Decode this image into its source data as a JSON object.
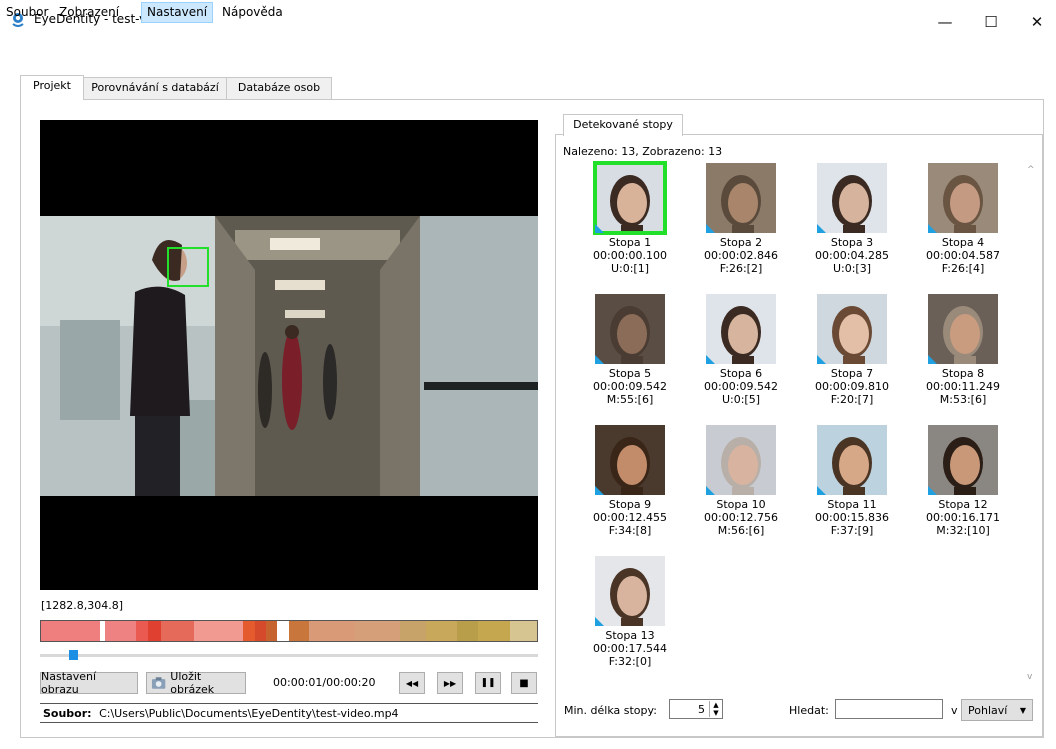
{
  "window": {
    "title": "EyeDentity - test-video",
    "minimize": "—",
    "maximize": "☐",
    "close": "✕"
  },
  "menu": [
    "Soubor",
    "Zobrazení",
    "Nastavení",
    "Nápověda"
  ],
  "tabs": [
    "Projekt",
    "Porovnávání s databází",
    "Databáze osob"
  ],
  "player": {
    "coordinates": "[1282.8,304.8]",
    "settings_button": "Nastavení obrazu",
    "save_button": "Uložit obrázek",
    "time": "00:00:01/00:00:20",
    "progress_fraction": 0.05,
    "file_label": "Soubor:",
    "file_path": "C:\\Users\\Public\\Documents\\EyeDentity\\test-video.mp4",
    "btn_rewind": "◀◀",
    "btn_forward": "▶▶",
    "btn_pause": "❚❚",
    "btn_stop": "■"
  },
  "timeline_colors": [
    "#ef7f7f",
    "#ffffff",
    "#ee8282",
    "#ea5a50",
    "#e04030",
    "#e66a5a",
    "#f09a92",
    "#e55b2e",
    "#d44a2a",
    "#c7632e",
    "#ffffff",
    "#c9763c",
    "#d89a77",
    "#d49f79",
    "#c7a36a",
    "#c8a85a",
    "#b89e4a",
    "#c5a750",
    "#d6c590"
  ],
  "right_panel": {
    "tab": "Detekované stopy",
    "summary": "Nalezeno: 13, Zobrazeno: 13",
    "min_length_label": "Min. délka stopy:",
    "min_length_value": "5",
    "search_label": "Hledat:",
    "search_value": "",
    "in_label": "v",
    "search_field_select": "Pohlaví"
  },
  "tracks": [
    {
      "name": "Stopa 1",
      "time": "00:00:00.100",
      "info": "U:0:[1]",
      "selected": true,
      "skin": "#d8b39a",
      "hair": "#3b2a22",
      "bg": "#d7dde3"
    },
    {
      "name": "Stopa 2",
      "time": "00:00:02.846",
      "info": "F:26:[2]",
      "selected": false,
      "skin": "#a9866b",
      "hair": "#5a4a3c",
      "bg": "#8b7a68"
    },
    {
      "name": "Stopa 3",
      "time": "00:00:04.285",
      "info": "U:0:[3]",
      "selected": false,
      "skin": "#d5b39c",
      "hair": "#3a2a22",
      "bg": "#dfe4ea"
    },
    {
      "name": "Stopa 4",
      "time": "00:00:04.587",
      "info": "F:26:[4]",
      "selected": false,
      "skin": "#c59a82",
      "hair": "#6a5442",
      "bg": "#9a8a7a"
    },
    {
      "name": "Stopa 5",
      "time": "00:00:09.542",
      "info": "M:55:[6]",
      "selected": false,
      "skin": "#8a6c58",
      "hair": "#4a3c32",
      "bg": "#5a4e44"
    },
    {
      "name": "Stopa 6",
      "time": "00:00:09.542",
      "info": "U:0:[5]",
      "selected": false,
      "skin": "#d6b49d",
      "hair": "#3b2a22",
      "bg": "#dfe4ea"
    },
    {
      "name": "Stopa 7",
      "time": "00:00:09.810",
      "info": "F:20:[7]",
      "selected": false,
      "skin": "#e2bfa6",
      "hair": "#6a4a34",
      "bg": "#cfd7df"
    },
    {
      "name": "Stopa 8",
      "time": "00:00:11.249",
      "info": "M:53:[6]",
      "selected": false,
      "skin": "#c99c80",
      "hair": "#9a8a7a",
      "bg": "#6a6058"
    },
    {
      "name": "Stopa 9",
      "time": "00:00:12.455",
      "info": "F:34:[8]",
      "selected": false,
      "skin": "#c28c6a",
      "hair": "#3a2618",
      "bg": "#4a3a2e"
    },
    {
      "name": "Stopa 10",
      "time": "00:00:12.756",
      "info": "M:56:[6]",
      "selected": false,
      "skin": "#d8b4a0",
      "hair": "#b8b0a8",
      "bg": "#c8ccd2"
    },
    {
      "name": "Stopa 11",
      "time": "00:00:15.836",
      "info": "F:37:[9]",
      "selected": false,
      "skin": "#d7a888",
      "hair": "#4a3424",
      "bg": "#bcd2de"
    },
    {
      "name": "Stopa 12",
      "time": "00:00:16.171",
      "info": "M:32:[10]",
      "selected": false,
      "skin": "#c89878",
      "hair": "#2a1e16",
      "bg": "#8a8682"
    },
    {
      "name": "Stopa 13",
      "time": "00:00:17.544",
      "info": "F:32:[0]",
      "selected": false,
      "skin": "#d8b49e",
      "hair": "#4a3426",
      "bg": "#e4e6ea"
    }
  ]
}
